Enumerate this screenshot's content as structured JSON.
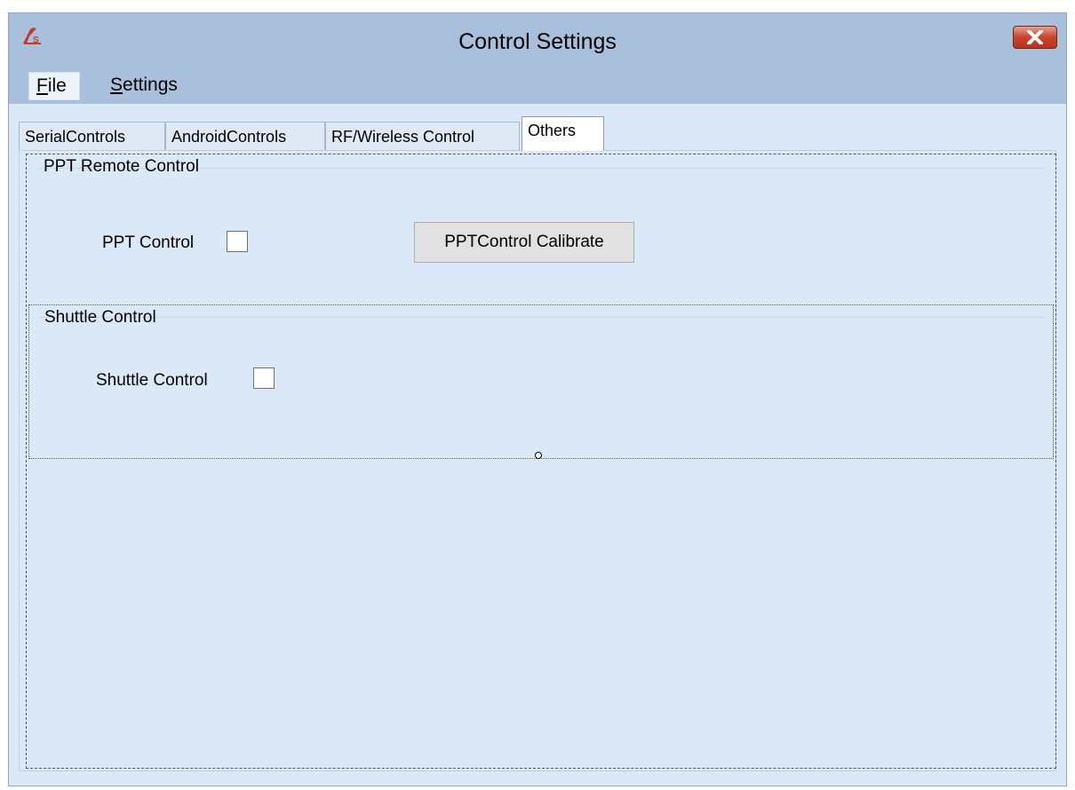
{
  "window": {
    "title": "Control Settings",
    "logo_icon": "fs-logo-icon",
    "close_icon": "close-icon",
    "accent_close": "#c8442c"
  },
  "menubar": {
    "file_label": "File",
    "settings_label": "Settings"
  },
  "tabs": [
    {
      "label": "SerialControls",
      "active": false
    },
    {
      "label": "AndroidControls",
      "active": false
    },
    {
      "label": "RF/Wireless Control",
      "active": false
    },
    {
      "label": "Others",
      "active": true
    }
  ],
  "ppt_group": {
    "title": "PPT Remote Control",
    "ppt_control_label": "PPT Control",
    "ppt_control_checked": false,
    "calibrate_button_label": "PPTControl Calibrate"
  },
  "shuttle_group": {
    "title": "Shuttle Control",
    "shuttle_control_label": "Shuttle Control",
    "shuttle_control_checked": false
  }
}
